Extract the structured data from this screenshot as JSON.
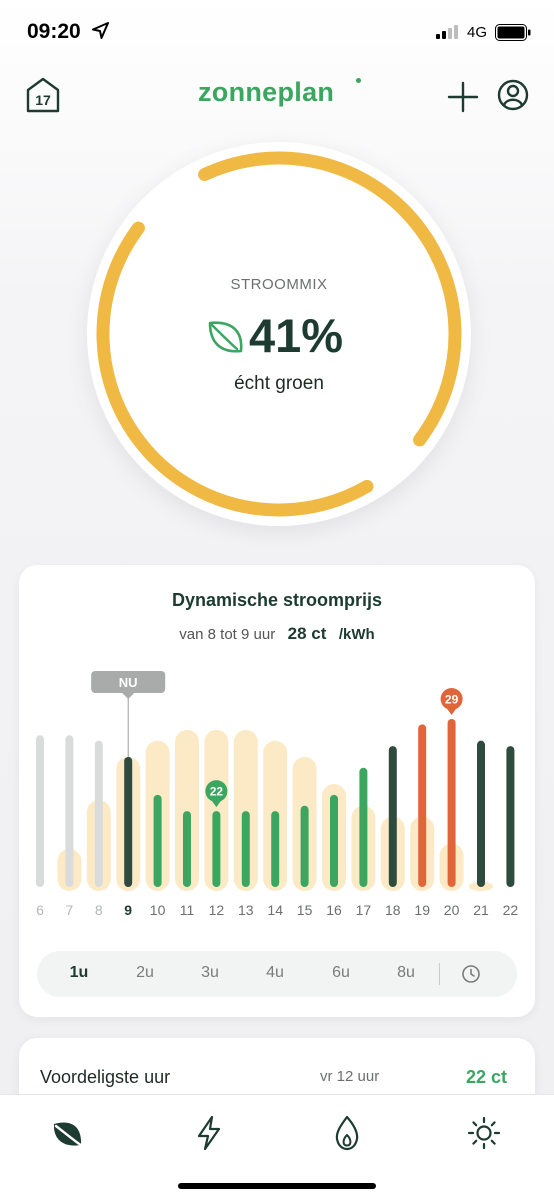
{
  "status_bar": {
    "time": "09:20",
    "network": "4G",
    "location_icon": "location-arrow-icon",
    "signal_icon": "cell-signal-icon",
    "battery_icon": "battery-icon"
  },
  "header": {
    "home_badge": "17",
    "home_icon": "house-icon",
    "logo": "zonneplan",
    "add_icon": "plus-icon",
    "account_icon": "user-circle-icon"
  },
  "stroommix": {
    "label": "STROOMMIX",
    "value": "41%",
    "subtitle": "écht groen",
    "icon": "leaf-icon",
    "ring_color": "#f0b944"
  },
  "price_card": {
    "title": "Dynamische stroomprijs",
    "range_text": "van 8 tot 9 uur",
    "price": "28 ct",
    "unit": "/kWh",
    "now_label": "NU",
    "ranges": [
      "1u",
      "2u",
      "3u",
      "4u",
      "6u",
      "8u"
    ],
    "active_range": "1u",
    "clock_icon": "clock-icon"
  },
  "chart_data": {
    "type": "bar",
    "categories": [
      "6",
      "7",
      "8",
      "9",
      "10",
      "11",
      "12",
      "13",
      "14",
      "15",
      "16",
      "17",
      "18",
      "19",
      "20",
      "21",
      "22"
    ],
    "values": [
      28,
      28,
      27,
      24,
      17,
      14,
      14,
      14,
      14,
      15,
      17,
      22,
      26,
      30,
      31,
      27,
      26
    ],
    "solar_background": [
      0,
      7,
      16,
      24,
      27,
      29,
      29,
      29,
      27,
      24,
      19,
      15,
      13,
      13,
      8,
      1,
      0
    ],
    "status": [
      "past",
      "past",
      "past",
      "current",
      "green",
      "green",
      "green",
      "green",
      "green",
      "green",
      "green",
      "green",
      "dark",
      "orange",
      "orange",
      "dark",
      "dark"
    ],
    "current_category": "9",
    "min_marker": {
      "category": "12",
      "label": "22"
    },
    "max_marker": {
      "category": "20",
      "label": "29"
    },
    "ylim": [
      0,
      31
    ],
    "colors": {
      "past": "#d9dcdb",
      "current": "#2f4b3f",
      "green": "#3aa660",
      "dark": "#2f4b3f",
      "orange": "#e0663a",
      "solar": "#fbe3b3"
    }
  },
  "cheapest": {
    "label": "Voordeligste uur",
    "time": "vr 12 uur",
    "price": "22 ct"
  },
  "tabbar": {
    "tabs": [
      "leaf-tab-icon",
      "lightning-tab-icon",
      "flame-tab-icon",
      "sun-tab-icon"
    ],
    "active_color": "#1d3b31"
  }
}
